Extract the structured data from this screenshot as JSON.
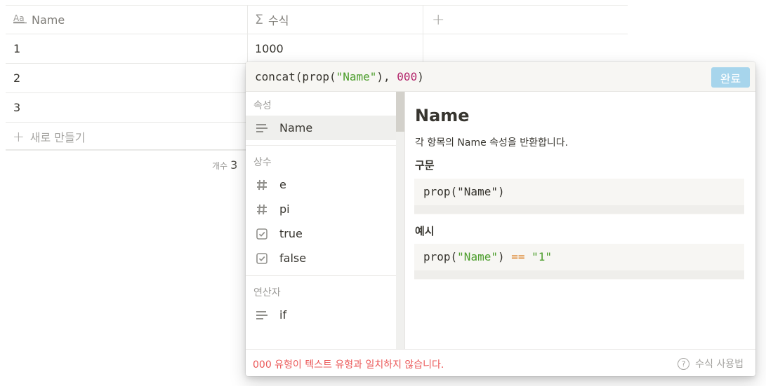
{
  "table": {
    "columns": [
      {
        "label": "Name",
        "icon": "text-type-icon"
      },
      {
        "label": "수식",
        "icon": "sigma-icon"
      },
      {
        "label": "+",
        "icon": "plus-icon"
      }
    ],
    "rows": [
      {
        "name": "1",
        "formula": "1000"
      },
      {
        "name": "2",
        "formula": ""
      },
      {
        "name": "3",
        "formula": ""
      }
    ],
    "new_row_label": "새로 만들기",
    "count_label": "개수",
    "count_value": "3"
  },
  "popup": {
    "formula": {
      "t1": "concat(prop(",
      "t2": "\"Name\"",
      "t3": "), ",
      "t4": "000",
      "t5": ")"
    },
    "done_label": "완료",
    "sections": {
      "properties": {
        "title": "속성",
        "items": [
          {
            "label": "Name",
            "icon": "text-lines-icon"
          }
        ]
      },
      "constants": {
        "title": "상수",
        "items": [
          {
            "label": "e",
            "icon": "hash-icon"
          },
          {
            "label": "pi",
            "icon": "hash-icon"
          },
          {
            "label": "true",
            "icon": "checkbox-icon"
          },
          {
            "label": "false",
            "icon": "checkbox-icon"
          }
        ]
      },
      "operators": {
        "title": "연산자",
        "items": [
          {
            "label": "if",
            "icon": "text-lines-icon"
          }
        ]
      }
    },
    "detail": {
      "title": "Name",
      "description": "각 항목의 Name 속성을 반환합니다.",
      "syntax_heading": "구문",
      "syntax_code": {
        "a": "prop(\"Name\")"
      },
      "example_heading": "예시",
      "example_code": {
        "a": "prop(",
        "b": "\"Name\"",
        "c": ") ",
        "d": "==",
        "e": " ",
        "f": "\"1\""
      }
    },
    "error_text": "000 유형이 텍스트 유형과 일치하지 않습니다.",
    "help_label": "수식 사용법"
  },
  "colors": {
    "accent_button": "#a7d5ec",
    "error": "#eb5757",
    "string_token": "#4d9e2d",
    "number_token": "#b3256b",
    "operator_token": "#d9730d"
  }
}
